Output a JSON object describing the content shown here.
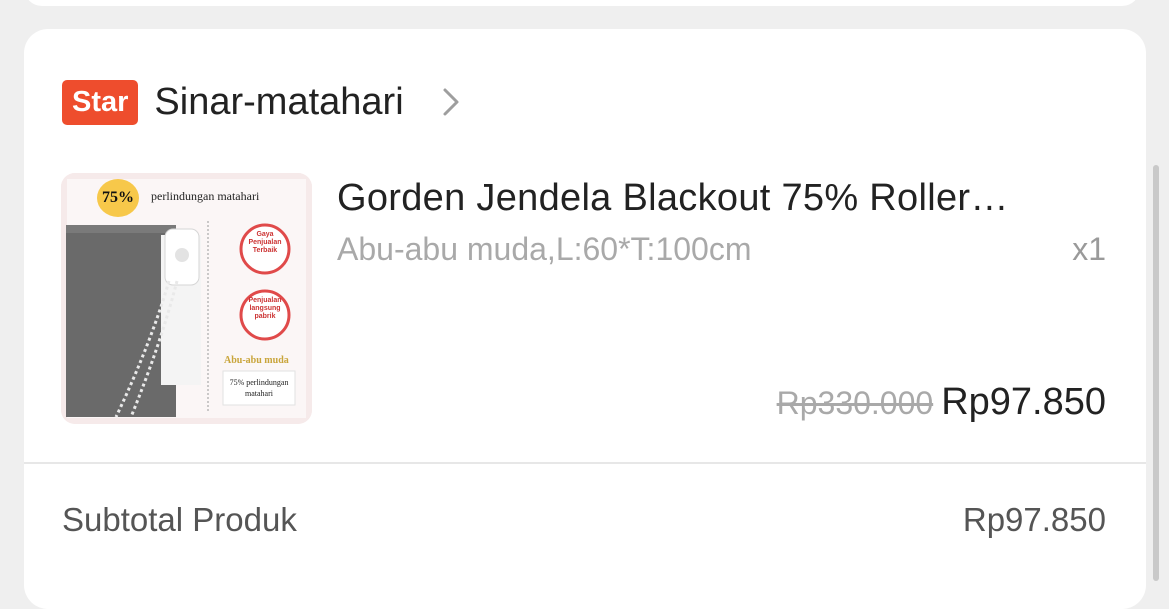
{
  "shop": {
    "badge": "Star",
    "name": "Sinar-matahari"
  },
  "product": {
    "title": "Gorden Jendela Blackout 75% Roller…",
    "variant": "Abu-abu muda,L:60*T:100cm",
    "quantity": "x1",
    "original_price": "Rp330.000",
    "price": "Rp97.850",
    "image": {
      "percent_badge": "75%",
      "banner_text": "perlindungan matahari",
      "stamp1_text": "Gaya Penjualan Terbaik",
      "stamp2_text": "Penjualan langsung pabrik",
      "color_label": "Abu-abu muda",
      "caption": "75% perlindungan matahari"
    }
  },
  "summary": {
    "subtotal_label": "Subtotal Produk",
    "subtotal_value": "Rp97.850"
  },
  "colors": {
    "accent": "#ee4d2d",
    "background": "#efefef",
    "card": "#ffffff"
  }
}
